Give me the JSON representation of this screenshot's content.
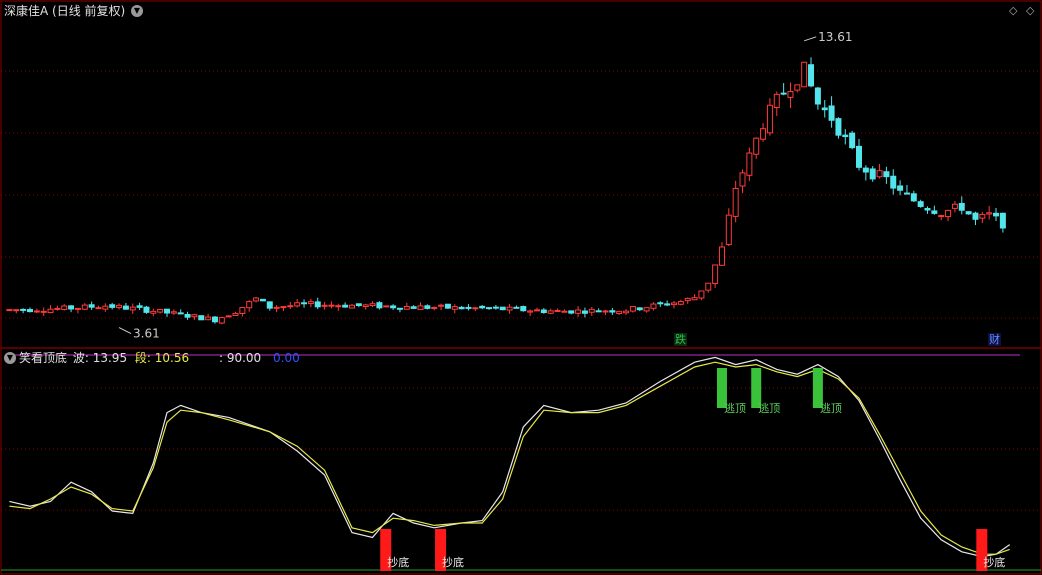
{
  "header": {
    "title": "深康佳A",
    "period": "(日线 前复权)"
  },
  "indicator": {
    "name": "笑看顶底",
    "bo_label": "波:",
    "bo_value": "13.95",
    "duan_label": "段:",
    "duan_value": "10.56",
    "v3": ": 90.00",
    "v4": "0.00"
  },
  "price": {
    "high_label": "13.61",
    "low_label": "3.61"
  },
  "event_tags": [
    {
      "text": "跌",
      "color": "#2fc04a"
    },
    {
      "text": "财",
      "color": "#6b8cff"
    }
  ],
  "signals": {
    "top_label": "逃顶",
    "bottom_label": "抄底"
  },
  "colors": {
    "up": "#ff3a3a",
    "down": "#52e6ec",
    "grid": "#8a0000",
    "line_white": "#e8e8e8",
    "line_yellow": "#e8e84a",
    "level": "#c030c0",
    "baseline": "#1fa01f"
  },
  "chart_data": [
    {
      "type": "candlestick",
      "title": "深康佳A (日线 前复权)",
      "ylim": [
        3.2,
        14.5
      ],
      "annotations": [
        {
          "text": "13.61",
          "x": 116,
          "y": 13.61
        },
        {
          "text": "3.61",
          "x": 16,
          "y": 3.61
        }
      ],
      "close_path": [
        [
          0,
          4.1
        ],
        [
          8,
          4.15
        ],
        [
          14,
          4.25
        ],
        [
          20,
          4.1
        ],
        [
          26,
          3.9
        ],
        [
          30,
          3.75
        ],
        [
          33,
          4.05
        ],
        [
          36,
          4.5
        ],
        [
          38,
          4.2
        ],
        [
          44,
          4.3
        ],
        [
          52,
          4.25
        ],
        [
          60,
          4.2
        ],
        [
          70,
          4.15
        ],
        [
          80,
          4.05
        ],
        [
          90,
          4.1
        ],
        [
          98,
          4.4
        ],
        [
          100,
          4.55
        ],
        [
          102,
          5.1
        ],
        [
          104,
          6.3
        ],
        [
          106,
          8.5
        ],
        [
          108,
          9.6
        ],
        [
          110,
          10.8
        ],
        [
          112,
          11.6
        ],
        [
          114,
          12.2
        ],
        [
          116,
          12.7
        ],
        [
          118,
          11.5
        ],
        [
          120,
          11.0
        ],
        [
          122,
          10.2
        ],
        [
          124,
          9.3
        ],
        [
          126,
          9.0
        ],
        [
          128,
          8.8
        ],
        [
          130,
          8.3
        ],
        [
          133,
          7.9
        ],
        [
          136,
          7.6
        ],
        [
          139,
          7.8
        ],
        [
          141,
          7.3
        ],
        [
          143,
          7.5
        ],
        [
          145,
          7.2
        ]
      ],
      "marks": [
        {
          "index": 96,
          "text": "跌"
        },
        {
          "index": 141,
          "text": "财"
        }
      ]
    },
    {
      "type": "line",
      "title": "笑看顶底",
      "ylim": [
        0,
        100
      ],
      "series": [
        {
          "name": "波",
          "color": "#e8e8e8",
          "last": 13.95,
          "points": [
            [
              0,
              29
            ],
            [
              3,
              27
            ],
            [
              6,
              29
            ],
            [
              9,
              37
            ],
            [
              12,
              33
            ],
            [
              15,
              25
            ],
            [
              18,
              24
            ],
            [
              21,
              45
            ],
            [
              23,
              66
            ],
            [
              25,
              69
            ],
            [
              28,
              66
            ],
            [
              32,
              64
            ],
            [
              38,
              58
            ],
            [
              42,
              50
            ],
            [
              46,
              40
            ],
            [
              50,
              16
            ],
            [
              53,
              14
            ],
            [
              56,
              24
            ],
            [
              59,
              20
            ],
            [
              62,
              18
            ],
            [
              66,
              20
            ],
            [
              69,
              21
            ],
            [
              72,
              33
            ],
            [
              75,
              60
            ],
            [
              78,
              69
            ],
            [
              82,
              66
            ],
            [
              86,
              67
            ],
            [
              90,
              70
            ],
            [
              95,
              79
            ],
            [
              100,
              87
            ],
            [
              103,
              89
            ],
            [
              106,
              86
            ],
            [
              109,
              88
            ],
            [
              112,
              84
            ],
            [
              115,
              82
            ],
            [
              118,
              86
            ],
            [
              121,
              81
            ],
            [
              124,
              71
            ],
            [
              127,
              55
            ],
            [
              130,
              38
            ],
            [
              133,
              22
            ],
            [
              136,
              13
            ],
            [
              139,
              8
            ],
            [
              142,
              6
            ],
            [
              144,
              7
            ],
            [
              146,
              11
            ]
          ]
        },
        {
          "name": "段",
          "color": "#e8e84a",
          "last": 10.56,
          "points": [
            [
              0,
              27
            ],
            [
              3,
              26
            ],
            [
              6,
              30
            ],
            [
              9,
              35
            ],
            [
              12,
              32
            ],
            [
              15,
              26
            ],
            [
              18,
              25
            ],
            [
              21,
              43
            ],
            [
              23,
              62
            ],
            [
              25,
              67
            ],
            [
              28,
              66
            ],
            [
              32,
              63
            ],
            [
              38,
              58
            ],
            [
              42,
              52
            ],
            [
              46,
              42
            ],
            [
              50,
              18
            ],
            [
              53,
              16
            ],
            [
              56,
              22
            ],
            [
              59,
              21
            ],
            [
              62,
              19
            ],
            [
              66,
              20
            ],
            [
              69,
              20
            ],
            [
              72,
              30
            ],
            [
              75,
              56
            ],
            [
              78,
              67
            ],
            [
              82,
              66
            ],
            [
              86,
              66
            ],
            [
              90,
              69
            ],
            [
              95,
              77
            ],
            [
              100,
              85
            ],
            [
              103,
              87
            ],
            [
              106,
              85
            ],
            [
              109,
              86
            ],
            [
              112,
              83
            ],
            [
              115,
              81
            ],
            [
              118,
              84
            ],
            [
              121,
              80
            ],
            [
              124,
              72
            ],
            [
              127,
              57
            ],
            [
              130,
              41
            ],
            [
              133,
              25
            ],
            [
              136,
              15
            ],
            [
              139,
              10
            ],
            [
              142,
              7
            ],
            [
              144,
              7
            ],
            [
              146,
              9
            ]
          ]
        }
      ],
      "level": 90,
      "signals": [
        {
          "index": 104,
          "type": "top"
        },
        {
          "index": 109,
          "type": "top"
        },
        {
          "index": 118,
          "type": "top"
        },
        {
          "index": 55,
          "type": "bottom"
        },
        {
          "index": 63,
          "type": "bottom"
        },
        {
          "index": 142,
          "type": "bottom"
        }
      ]
    }
  ]
}
